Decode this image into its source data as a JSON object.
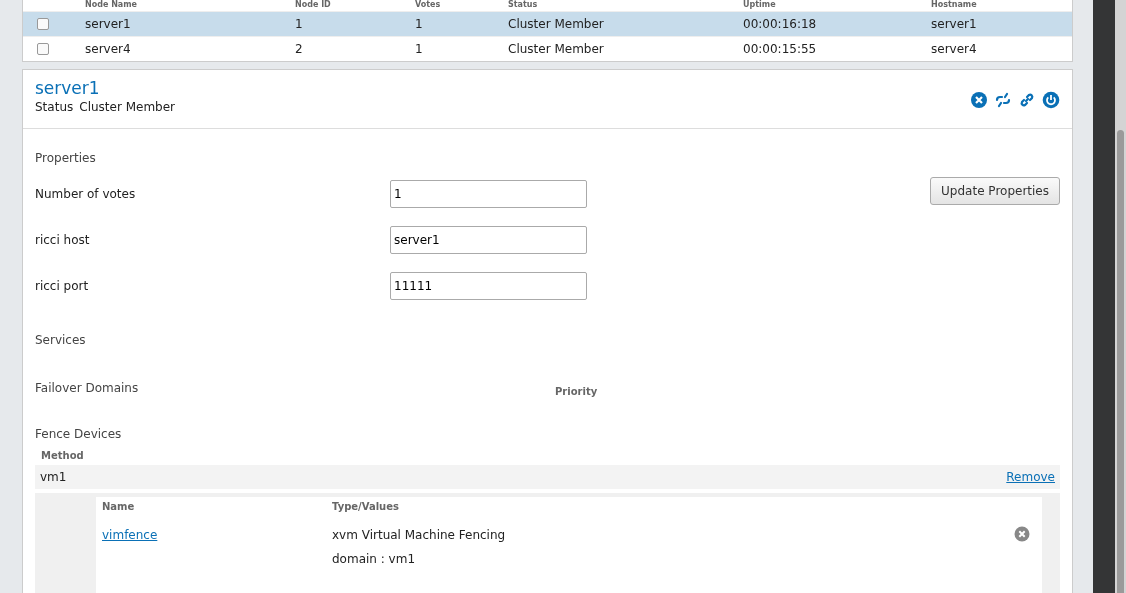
{
  "nodes_table": {
    "columns": [
      "Node Name",
      "Node ID",
      "Votes",
      "Status",
      "Uptime",
      "Hostname"
    ],
    "rows": [
      {
        "selected": true,
        "checked": false,
        "cells": [
          "server1",
          "1",
          "1",
          "Cluster Member",
          "00:00:16:18",
          "server1"
        ]
      },
      {
        "selected": false,
        "checked": false,
        "cells": [
          "server4",
          "2",
          "1",
          "Cluster Member",
          "00:00:15:55",
          "server4"
        ]
      }
    ]
  },
  "node": {
    "title": "server1",
    "status_label": "Status",
    "status": "Cluster Member",
    "actions": [
      {
        "kind": "close"
      },
      {
        "kind": "unlink"
      },
      {
        "kind": "link"
      },
      {
        "kind": "power"
      }
    ],
    "properties_heading": "Properties",
    "update_button": "Update Properties",
    "properties": [
      {
        "label": "Number of votes",
        "value": "1"
      },
      {
        "label": "ricci host",
        "value": "server1"
      },
      {
        "label": "ricci port",
        "value": "11111"
      }
    ],
    "services_heading": "Services",
    "failover_heading": "Failover Domains",
    "priority_header": "Priority",
    "fence_heading": "Fence Devices",
    "method_header": "Method",
    "methods": [
      {
        "name": "vm1",
        "remove": "Remove",
        "name_header": "Name",
        "type_header": "Type/Values",
        "devices": [
          {
            "name": "vimfence",
            "type": "xvm Virtual Machine Fencing",
            "values": [
              "domain : vm1"
            ]
          }
        ]
      }
    ]
  }
}
